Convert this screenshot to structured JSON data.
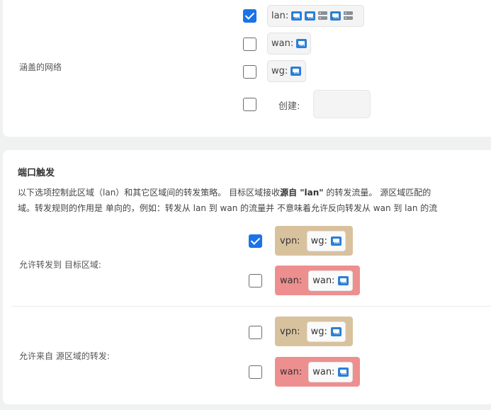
{
  "coverage": {
    "label": "涵盖的网络",
    "networks": [
      {
        "name": "lan:",
        "checked": true,
        "icons": [
          "port-icon",
          "port-icon",
          "server-icon",
          "port-icon",
          "server-icon"
        ]
      },
      {
        "name": "wan:",
        "checked": false,
        "icons": [
          "port-icon"
        ]
      },
      {
        "name": "wg:",
        "checked": false,
        "icons": [
          "port-icon"
        ]
      }
    ],
    "create": {
      "checked": false,
      "label": "创建:",
      "value": ""
    }
  },
  "forwarding": {
    "title": "端口触发",
    "desc_line1_pre": "以下选项控制此区域（lan）和其它区域间的转发策略。 目标区域接收",
    "desc_line1_bold": "源自 \"lan\"",
    "desc_line1_post": " 的转发流量。 源区域匹配的",
    "desc_line2": "域。转发规则的作用是  单向的，例如：转发从 lan 到 wan 的流量并  不意味着允许反向转发从 wan 到 lan 的流",
    "dest": {
      "label": "允许转发到  目标区域:",
      "zones": [
        {
          "zone": "vpn:",
          "network": "wg:",
          "checked": true
        },
        {
          "zone": "wan:",
          "network": "wan:",
          "checked": false
        }
      ]
    },
    "src": {
      "label": "允许来自  源区域的转发:",
      "zones": [
        {
          "zone": "vpn:",
          "network": "wg:",
          "checked": false
        },
        {
          "zone": "wan:",
          "network": "wan:",
          "checked": false
        }
      ]
    }
  },
  "colors": {
    "vpn_zone": "#d8c29e",
    "wan_zone": "#ee8f8f",
    "checkbox_checked": "#1a73e8"
  }
}
